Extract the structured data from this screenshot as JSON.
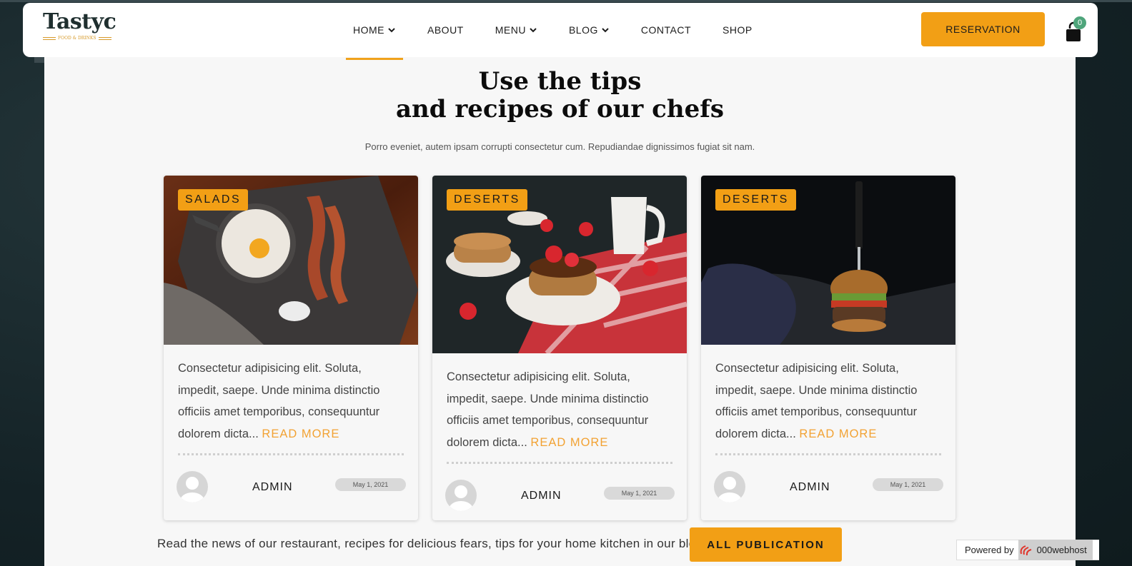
{
  "header": {
    "logo_word": "Tastyc",
    "logo_sub": "FOOD & DRINKS",
    "nav": [
      {
        "label": "HOME",
        "dropdown": true,
        "active": true
      },
      {
        "label": "ABOUT",
        "dropdown": false
      },
      {
        "label": "MENU",
        "dropdown": true
      },
      {
        "label": "BLOG",
        "dropdown": true
      },
      {
        "label": "CONTACT",
        "dropdown": false
      },
      {
        "label": "SHOP",
        "dropdown": false
      }
    ],
    "reservation_label": "RESERVATION",
    "cart_count": "0"
  },
  "section": {
    "title_line1": "Use the tips",
    "title_line2": "and recipes of our chefs",
    "subtitle": "Porro eveniet, autem ipsam corrupti consectetur cum. Repudiandae dignissimos fugiat sit nam."
  },
  "cards": [
    {
      "tag": "SALADS",
      "excerpt": "Consectetur adipisicing elit. Soluta, impedit, saepe. Unde minima distinctio officiis amet temporibus, consequuntur dolorem dicta...",
      "read_more": "READ MORE",
      "author": "ADMIN",
      "date": "May 1, 2021"
    },
    {
      "tag": "DESERTS",
      "excerpt": "Consectetur adipisicing elit. Soluta, impedit, saepe. Unde minima distinctio officiis amet temporibus, consequuntur dolorem dicta...",
      "read_more": "READ MORE",
      "author": "ADMIN",
      "date": "May 1, 2021"
    },
    {
      "tag": "DESERTS",
      "excerpt": "Consectetur adipisicing elit. Soluta, impedit, saepe. Unde minima distinctio officiis amet temporibus, consequuntur dolorem dicta...",
      "read_more": "READ MORE",
      "author": "ADMIN",
      "date": "May 1, 2021"
    }
  ],
  "footer_row": {
    "text": "Read the news of our restaurant, recipes for delicious fears, tips for your home kitchen in our blog!",
    "button": "ALL PUBLICATION"
  },
  "badge": {
    "powered": "Powered by",
    "host": "000webhost"
  },
  "colors": {
    "accent": "#f29f15",
    "read_more": "#f2a233",
    "cart_badge": "#4ea57b"
  }
}
